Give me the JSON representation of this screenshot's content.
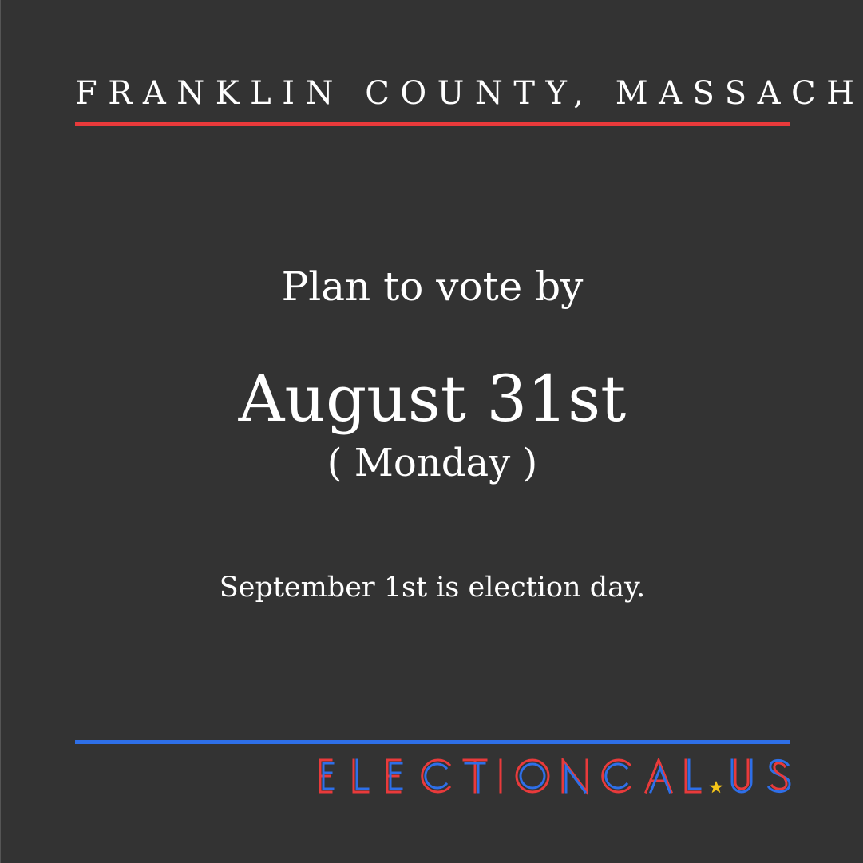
{
  "header": {
    "county": "FRANKLIN COUNTY, MASSACHUSETTS"
  },
  "message": {
    "lead": "Plan to vote by",
    "date": "August 31st",
    "weekday": "( Monday )",
    "note": "September 1st is election day."
  },
  "brand": {
    "logo_text": "ELECTIONCAL.US"
  },
  "colors": {
    "background": "#333333",
    "accent_red": "#e93a3b",
    "accent_blue": "#2e6fe8",
    "star_yellow": "#f5c518",
    "text": "#ffffff"
  }
}
